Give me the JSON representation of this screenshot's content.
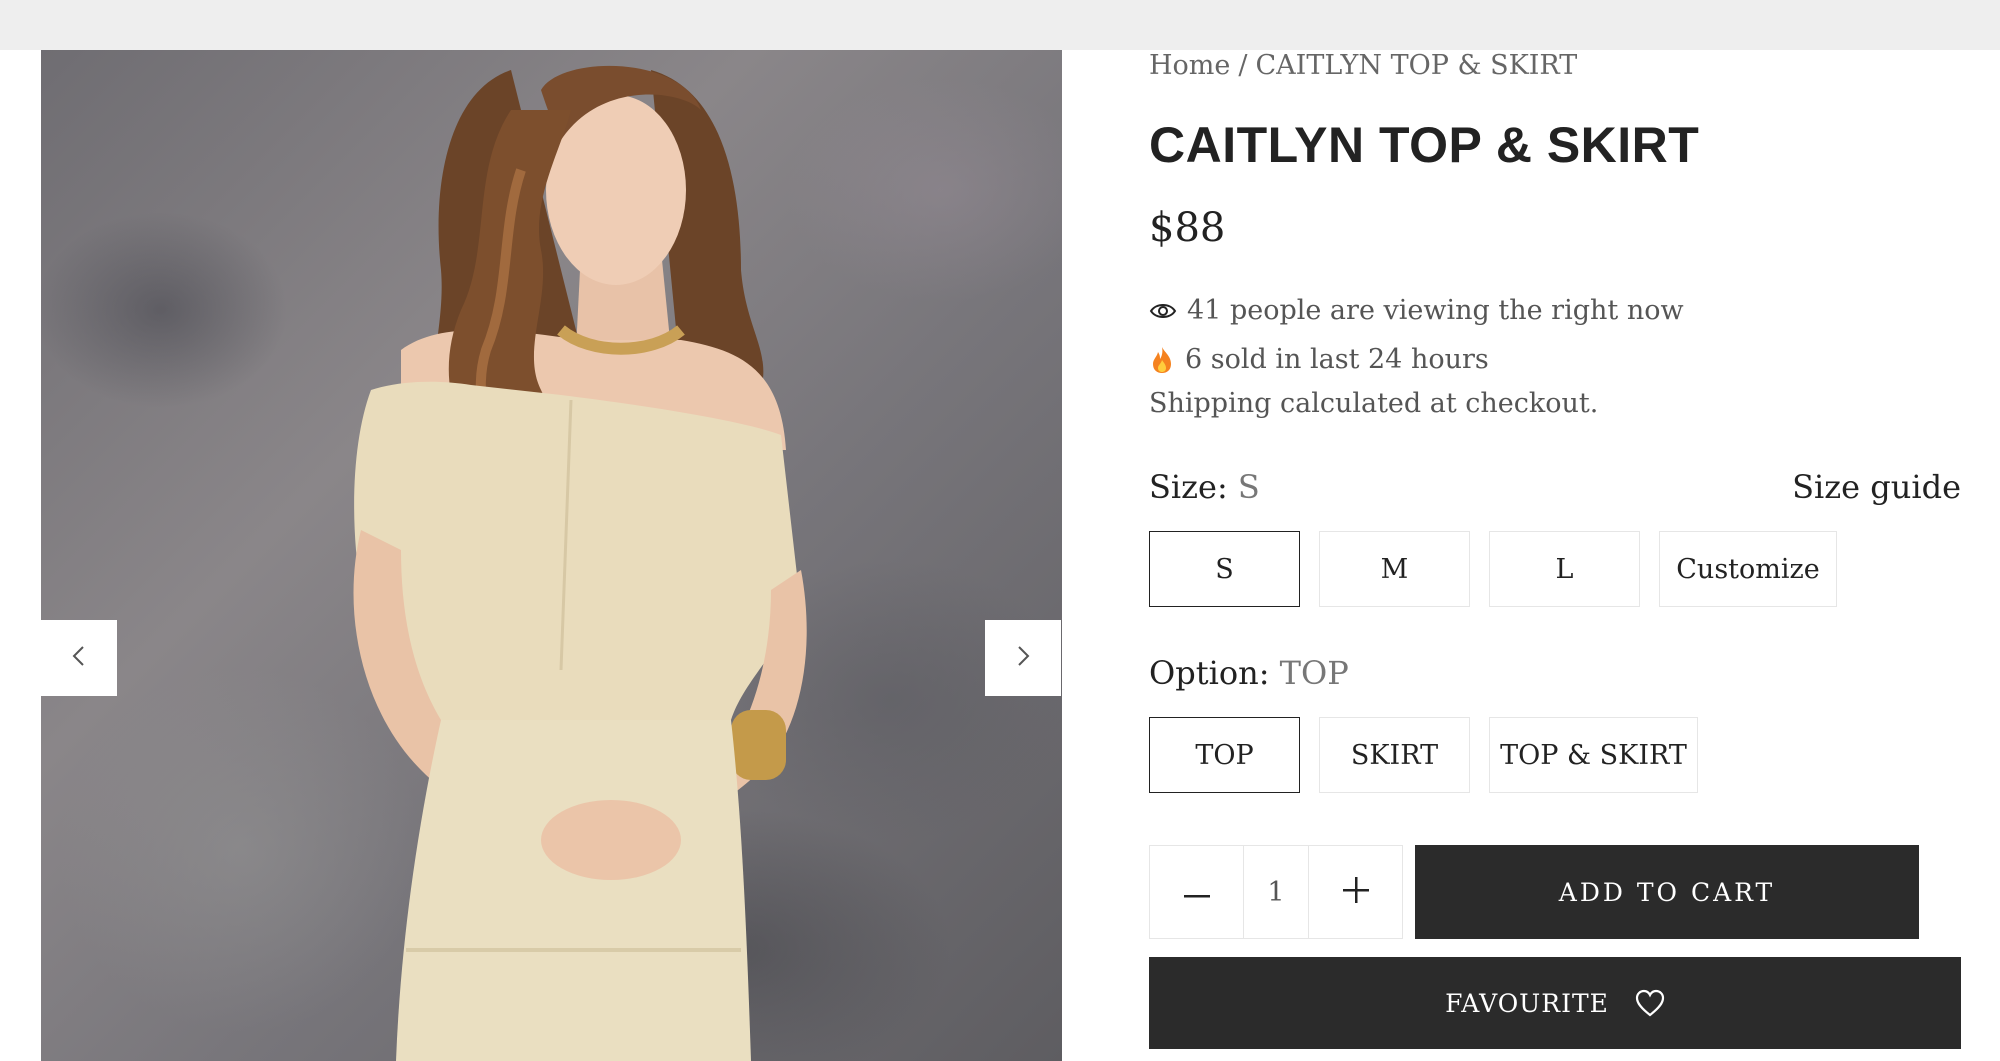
{
  "breadcrumb": {
    "home": "Home",
    "separator": "/",
    "current": "CAITLYN TOP & SKIRT"
  },
  "product": {
    "title": "CAITLYN TOP & SKIRT",
    "price": "$88",
    "viewing_text": "41 people are viewing the right now",
    "sold_text": "6 sold in last 24 hours",
    "shipping_text": "Shipping calculated at checkout."
  },
  "size": {
    "label": "Size:",
    "selected": "S",
    "guide_label": "Size guide",
    "options": [
      "S",
      "M",
      "L",
      "Customize"
    ]
  },
  "option": {
    "label": "Option:",
    "selected": "TOP",
    "options": [
      "TOP",
      "SKIRT",
      "TOP & SKIRT"
    ]
  },
  "quantity": {
    "value": "1"
  },
  "buttons": {
    "add_to_cart": "ADD TO CART",
    "favourite": "FAVOURITE"
  },
  "icons": {
    "prev": "chevron-left-icon",
    "next": "chevron-right-icon",
    "viewing": "eye-icon",
    "sold": "fire-icon",
    "minus": "minus-icon",
    "plus": "plus-icon",
    "favourite": "heart-icon"
  },
  "colors": {
    "button_bg": "#2b2b2b",
    "page_bg": "#ffffff",
    "topbar_bg": "#eeeeee"
  }
}
